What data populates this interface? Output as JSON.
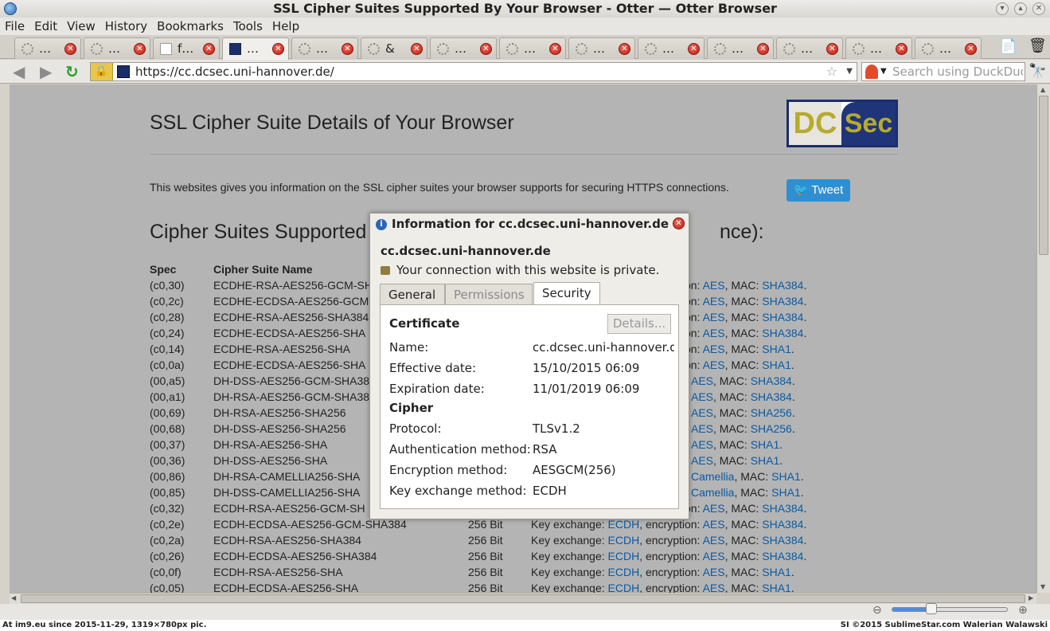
{
  "window": {
    "title": "SSL Cipher Suites Supported By Your Browser - Otter — Otter Browser"
  },
  "menu": [
    "File",
    "Edit",
    "View",
    "History",
    "Bookmarks",
    "Tools",
    "Help"
  ],
  "tabs": [
    {
      "label": "…",
      "fav": "loading"
    },
    {
      "label": "…",
      "fav": "loading"
    },
    {
      "label": "f…",
      "fav": "page"
    },
    {
      "label": "…",
      "fav": "dcsec"
    },
    {
      "label": "…",
      "fav": "loading"
    },
    {
      "label": "&",
      "fav": "loading"
    },
    {
      "label": "…",
      "fav": "loading"
    },
    {
      "label": "…",
      "fav": "loading"
    },
    {
      "label": "…",
      "fav": "loading"
    },
    {
      "label": "…",
      "fav": "loading"
    },
    {
      "label": "…",
      "fav": "loading"
    },
    {
      "label": "…",
      "fav": "loading"
    },
    {
      "label": "…",
      "fav": "loading"
    },
    {
      "label": "…",
      "fav": "loading"
    }
  ],
  "toolbar": {
    "url": "https://cc.dcsec.uni-hannover.de/",
    "search_placeholder": "Search using DuckDuckGo"
  },
  "page": {
    "title": "SSL Cipher Suite Details of Your Browser",
    "logo_left": "DC",
    "logo_right": "Sec",
    "intro": "This websites gives you information on the SSL cipher suites your browser supports for securing HTTPS connections.",
    "tweet": "Tweet",
    "heading_left": "Cipher Suites Supported",
    "heading_right": "nce):",
    "col_spec": "Spec",
    "col_name": "Cipher Suite Name",
    "rows": [
      {
        "spec": "(c0,30)",
        "name": "ECDHE-RSA-AES256-GCM-SH",
        "bits": "",
        "kx": "",
        "enc": "AES",
        "mac": "SHA384",
        "prefix": "on: "
      },
      {
        "spec": "(c0,2c)",
        "name": "ECDHE-ECDSA-AES256-GCM",
        "bits": "",
        "kx": "",
        "enc": "AES",
        "mac": "SHA384",
        "prefix": "on: "
      },
      {
        "spec": "(c0,28)",
        "name": "ECDHE-RSA-AES256-SHA384",
        "bits": "",
        "kx": "",
        "enc": "AES",
        "mac": "SHA384",
        "prefix": "on: "
      },
      {
        "spec": "(c0,24)",
        "name": "ECDHE-ECDSA-AES256-SHA",
        "bits": "",
        "kx": "",
        "enc": "AES",
        "mac": "SHA384",
        "prefix": "on: "
      },
      {
        "spec": "(c0,14)",
        "name": "ECDHE-RSA-AES256-SHA",
        "bits": "",
        "kx": "",
        "enc": "AES",
        "mac": "SHA1",
        "prefix": "on: "
      },
      {
        "spec": "(c0,0a)",
        "name": "ECDHE-ECDSA-AES256-SHA",
        "bits": "",
        "kx": "",
        "enc": "AES",
        "mac": "SHA1",
        "prefix": "on: "
      },
      {
        "spec": "(00,a5)",
        "name": "DH-DSS-AES256-GCM-SHA38",
        "bits": "",
        "kx": "",
        "enc": "AES",
        "mac": "SHA384",
        "prefix": ""
      },
      {
        "spec": "(00,a1)",
        "name": "DH-RSA-AES256-GCM-SHA38",
        "bits": "",
        "kx": "",
        "enc": "AES",
        "mac": "SHA384",
        "prefix": ""
      },
      {
        "spec": "(00,69)",
        "name": "DH-RSA-AES256-SHA256",
        "bits": "",
        "kx": "",
        "enc": "AES",
        "mac": "SHA256",
        "prefix": ""
      },
      {
        "spec": "(00,68)",
        "name": "DH-DSS-AES256-SHA256",
        "bits": "",
        "kx": "",
        "enc": "AES",
        "mac": "SHA256",
        "prefix": ""
      },
      {
        "spec": "(00,37)",
        "name": "DH-RSA-AES256-SHA",
        "bits": "",
        "kx": "",
        "enc": "AES",
        "mac": "SHA1",
        "prefix": ""
      },
      {
        "spec": "(00,36)",
        "name": "DH-DSS-AES256-SHA",
        "bits": "",
        "kx": "",
        "enc": "AES",
        "mac": "SHA1",
        "prefix": ""
      },
      {
        "spec": "(00,86)",
        "name": "DH-RSA-CAMELLIA256-SHA",
        "bits": "",
        "kx": "",
        "enc": "Camellia",
        "mac": "SHA1",
        "prefix": ""
      },
      {
        "spec": "(00,85)",
        "name": "DH-DSS-CAMELLIA256-SHA",
        "bits": "",
        "kx": "",
        "enc": "Camellia",
        "mac": "SHA1",
        "prefix": ""
      },
      {
        "spec": "(c0,32)",
        "name": "ECDH-RSA-AES256-GCM-SH",
        "bits": "",
        "kx": "",
        "enc": "AES",
        "mac": "SHA384",
        "prefix": "on: "
      },
      {
        "spec": "(c0,2e)",
        "name": "ECDH-ECDSA-AES256-GCM-SHA384",
        "bits": "256 Bit",
        "kx": "ECDH",
        "enc": "AES",
        "mac": "SHA384",
        "prefix": ""
      },
      {
        "spec": "(c0,2a)",
        "name": "ECDH-RSA-AES256-SHA384",
        "bits": "256 Bit",
        "kx": "ECDH",
        "enc": "AES",
        "mac": "SHA384",
        "prefix": ""
      },
      {
        "spec": "(c0,26)",
        "name": "ECDH-ECDSA-AES256-SHA384",
        "bits": "256 Bit",
        "kx": "ECDH",
        "enc": "AES",
        "mac": "SHA384",
        "prefix": ""
      },
      {
        "spec": "(c0,0f)",
        "name": "ECDH-RSA-AES256-SHA",
        "bits": "256 Bit",
        "kx": "ECDH",
        "enc": "AES",
        "mac": "SHA1",
        "prefix": ""
      },
      {
        "spec": "(c0,05)",
        "name": "ECDH-ECDSA-AES256-SHA",
        "bits": "256 Bit",
        "kx": "ECDH",
        "enc": "AES",
        "mac": "SHA1",
        "prefix": ""
      }
    ]
  },
  "dialog": {
    "title": "Information for cc.dcsec.uni-hannover.de",
    "host": "cc.dcsec.uni-hannover.de",
    "private": "Your connection with this website is private.",
    "tabs": [
      "General",
      "Permissions",
      "Security"
    ],
    "active_tab": "Security",
    "certificate_heading": "Certificate",
    "details_button": "Details...",
    "cert": [
      {
        "k": "Name:",
        "v": "cc.dcsec.uni-hannover.de"
      },
      {
        "k": "Effective date:",
        "v": "15/10/2015 06:09"
      },
      {
        "k": "Expiration date:",
        "v": "11/01/2019 06:09"
      }
    ],
    "cipher_heading": "Cipher",
    "cipher": [
      {
        "k": "Protocol:",
        "v": "TLSv1.2"
      },
      {
        "k": "Authentication method:",
        "v": "RSA"
      },
      {
        "k": "Encryption method:",
        "v": "AESGCM(256)"
      },
      {
        "k": "Key exchange method:",
        "v": "ECDH"
      }
    ]
  },
  "footer": {
    "left": "At im9.eu since 2015-11-29, 1319×780px pic.",
    "right": "SI ©2015 SublimeStar.com Walerian Walawski"
  },
  "colors": {
    "accent": "#0b5aa3",
    "tweet": "#2f8fd1",
    "lock": "#e8c64a"
  }
}
